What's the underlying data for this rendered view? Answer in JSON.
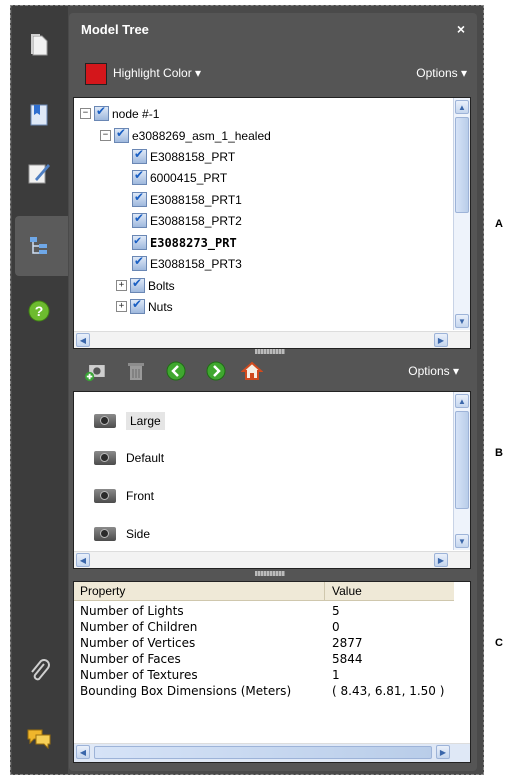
{
  "panel": {
    "title": "Model Tree",
    "close": "×"
  },
  "highlight": {
    "label": "Highlight Color",
    "color": "#d4161b"
  },
  "options_label": "Options",
  "tree": {
    "nodes": [
      {
        "label": "node #-1",
        "level": 0,
        "expander": "−"
      },
      {
        "label": "e3088269_asm_1_healed",
        "level": 1,
        "expander": "−"
      },
      {
        "label": "E3088158_PRT",
        "level": 2
      },
      {
        "label": "6000415_PRT",
        "level": 2
      },
      {
        "label": "E3088158_PRT1",
        "level": 2
      },
      {
        "label": "E3088158_PRT2",
        "level": 2
      },
      {
        "label": "E3088273_PRT",
        "level": 2,
        "bold": true
      },
      {
        "label": "E3088158_PRT3",
        "level": 2
      },
      {
        "label": "Bolts",
        "level": 2,
        "expander": "+"
      },
      {
        "label": "Nuts",
        "level": 2,
        "expander": "+"
      }
    ]
  },
  "views": {
    "options_label": "Options",
    "items": [
      {
        "label": "Large",
        "selected": true
      },
      {
        "label": "Default"
      },
      {
        "label": "Front"
      },
      {
        "label": "Side"
      }
    ]
  },
  "properties": {
    "headers": [
      "Property",
      "Value"
    ],
    "rows": [
      [
        "Number of Lights",
        "5"
      ],
      [
        "Number of Children",
        "0"
      ],
      [
        "Number of Vertices",
        "2877"
      ],
      [
        "Number of Faces",
        "5844"
      ],
      [
        "Number of Textures",
        "1"
      ],
      [
        "Bounding Box Dimensions (Meters)",
        "( 8.43, 6.81, 1.50 )"
      ]
    ]
  },
  "callouts": {
    "a": "A",
    "b": "B",
    "c": "C"
  },
  "toolbar_icons": [
    "pages-icon",
    "bookmarks-icon",
    "signatures-icon",
    "model-tree-icon",
    "help-icon",
    "attachments-icon",
    "comments-icon"
  ]
}
